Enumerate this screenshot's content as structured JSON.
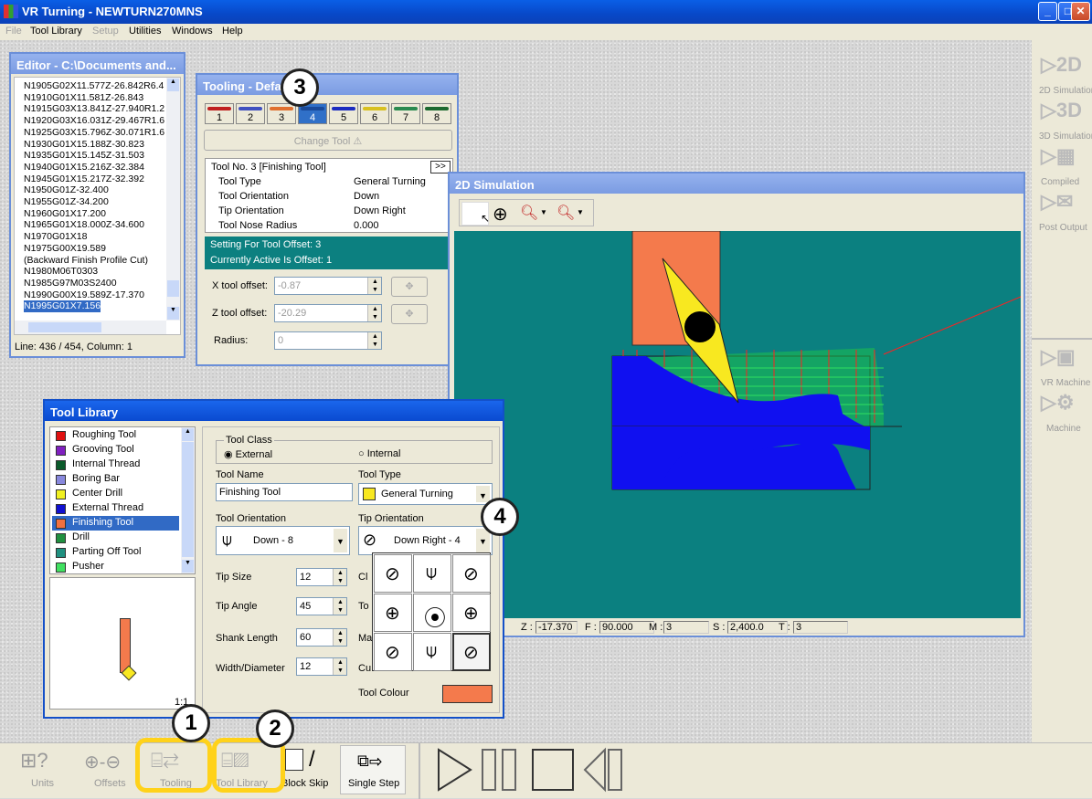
{
  "app": {
    "title": "VR Turning - NEWTURN270MNS",
    "minimize": "_",
    "maximize": "□",
    "close": "✕"
  },
  "menu": [
    {
      "label": "File",
      "enabled": false
    },
    {
      "label": "Tool Library",
      "enabled": true
    },
    {
      "label": "Setup",
      "enabled": false
    },
    {
      "label": "Utilities",
      "enabled": true
    },
    {
      "label": "Windows",
      "enabled": true
    },
    {
      "label": "Help",
      "enabled": true
    }
  ],
  "editor": {
    "title": "Editor - C:\\Documents and...",
    "lines": [
      "N1905G02X11.577Z-26.842R6.4",
      "N1910G01X11.581Z-26.843",
      "N1915G03X13.841Z-27.940R1.2",
      "N1920G03X16.031Z-29.467R1.6",
      "N1925G03X15.796Z-30.071R1.6",
      "N1930G01X15.188Z-30.823",
      "N1935G01X15.145Z-31.503",
      "N1940G01X15.216Z-32.384",
      "N1945G01X15.217Z-32.392",
      "N1950G01Z-32.400",
      "N1955G01Z-34.200",
      "N1960G01X17.200",
      "N1965G01X18.000Z-34.600",
      "N1970G01X18",
      "N1975G00X19.589",
      "(Backward Finish Profile Cut)",
      "N1980M06T0303",
      "N1985G97M03S2400",
      "N1990G00X19.589Z-17.370",
      "N1995G01X7.156"
    ],
    "status": "Line: 436 / 454, Column: 1"
  },
  "tooling": {
    "title": "Tooling - Defa",
    "tabs": [
      {
        "label": "1",
        "color": "#c02020"
      },
      {
        "label": "2",
        "color": "#4050c0"
      },
      {
        "label": "3",
        "color": "#e07030"
      },
      {
        "label": "4",
        "color": "#3070c8"
      },
      {
        "label": "5",
        "color": "#1c2cc0"
      },
      {
        "label": "6",
        "color": "#d8c020"
      },
      {
        "label": "7",
        "color": "#2a8a50"
      },
      {
        "label": "8",
        "color": "#1e6a30"
      }
    ],
    "change_tool": "Change Tool",
    "header": "Tool No. 3 [Finishing Tool]",
    "more": ">>",
    "props": [
      {
        "k": "Tool Type",
        "v": "General Turning"
      },
      {
        "k": "Tool Orientation",
        "v": "Down"
      },
      {
        "k": "Tip Orientation",
        "v": "Down Right"
      },
      {
        "k": "Tool Nose Radius",
        "v": "0.000"
      }
    ],
    "offset_line1": "Setting For Tool Offset: 3",
    "offset_line2": "Currently Active Is Offset: 1",
    "x_label": "X tool offset:",
    "x_value": "-0.87",
    "z_label": "Z tool offset:",
    "z_value": "-20.29",
    "r_label": "Radius:",
    "r_value": "0"
  },
  "sim": {
    "title": "2D Simulation",
    "status": [
      {
        "k": "Z :",
        "v": "-17.370"
      },
      {
        "k": "F :",
        "v": "90.000"
      },
      {
        "k": "M :",
        "v": "3"
      },
      {
        "k": "S :",
        "v": "2,400.0"
      },
      {
        "k": "T :",
        "v": "3"
      }
    ]
  },
  "library": {
    "title": "Tool Library",
    "items": [
      {
        "label": "Roughing Tool",
        "color": "#e01010"
      },
      {
        "label": "Grooving Tool",
        "color": "#8020c0"
      },
      {
        "label": "Internal Thread",
        "color": "#0a5a2a"
      },
      {
        "label": "Boring Bar",
        "color": "#8888dd"
      },
      {
        "label": "Center Drill",
        "color": "#f0f020"
      },
      {
        "label": "External Thread",
        "color": "#1010d0"
      },
      {
        "label": "Finishing Tool",
        "color": "#f07040"
      },
      {
        "label": "Drill",
        "color": "#209040"
      },
      {
        "label": "Parting Off Tool",
        "color": "#209080"
      },
      {
        "label": "Pusher",
        "color": "#40e060"
      }
    ],
    "scale": "1:1",
    "tool_class": "Tool Class",
    "external": "External",
    "internal": "Internal",
    "name_label": "Tool Name",
    "name_value": "Finishing Tool",
    "type_label": "Tool Type",
    "type_value": "General Turning",
    "orient_label": "Tool Orientation",
    "orient_value": "Down - 8",
    "tip_label": "Tip Orientation",
    "tip_value": "Down Right - 4",
    "params": [
      {
        "k": "Tip Size",
        "v": "12",
        "s": "Cl"
      },
      {
        "k": "Tip Angle",
        "v": "45",
        "s": "To"
      },
      {
        "k": "Shank Length",
        "v": "60",
        "s": "Ma"
      },
      {
        "k": "Width/Diameter",
        "v": "12",
        "s": "Cu"
      }
    ],
    "colour_label": "Tool Colour",
    "colour": "#f47a4c"
  },
  "right_panel": [
    "2D Simulation",
    "3D Simulation",
    "Compiled",
    "Post Output",
    "VR Machine",
    "Machine"
  ],
  "bottom": {
    "units": "Units",
    "offsets": "Offsets",
    "tooling": "Tooling",
    "tool_library": "Tool Library",
    "block_skip": "Block Skip",
    "single_step": "Single Step"
  },
  "badges": [
    "1",
    "2",
    "3",
    "4"
  ]
}
